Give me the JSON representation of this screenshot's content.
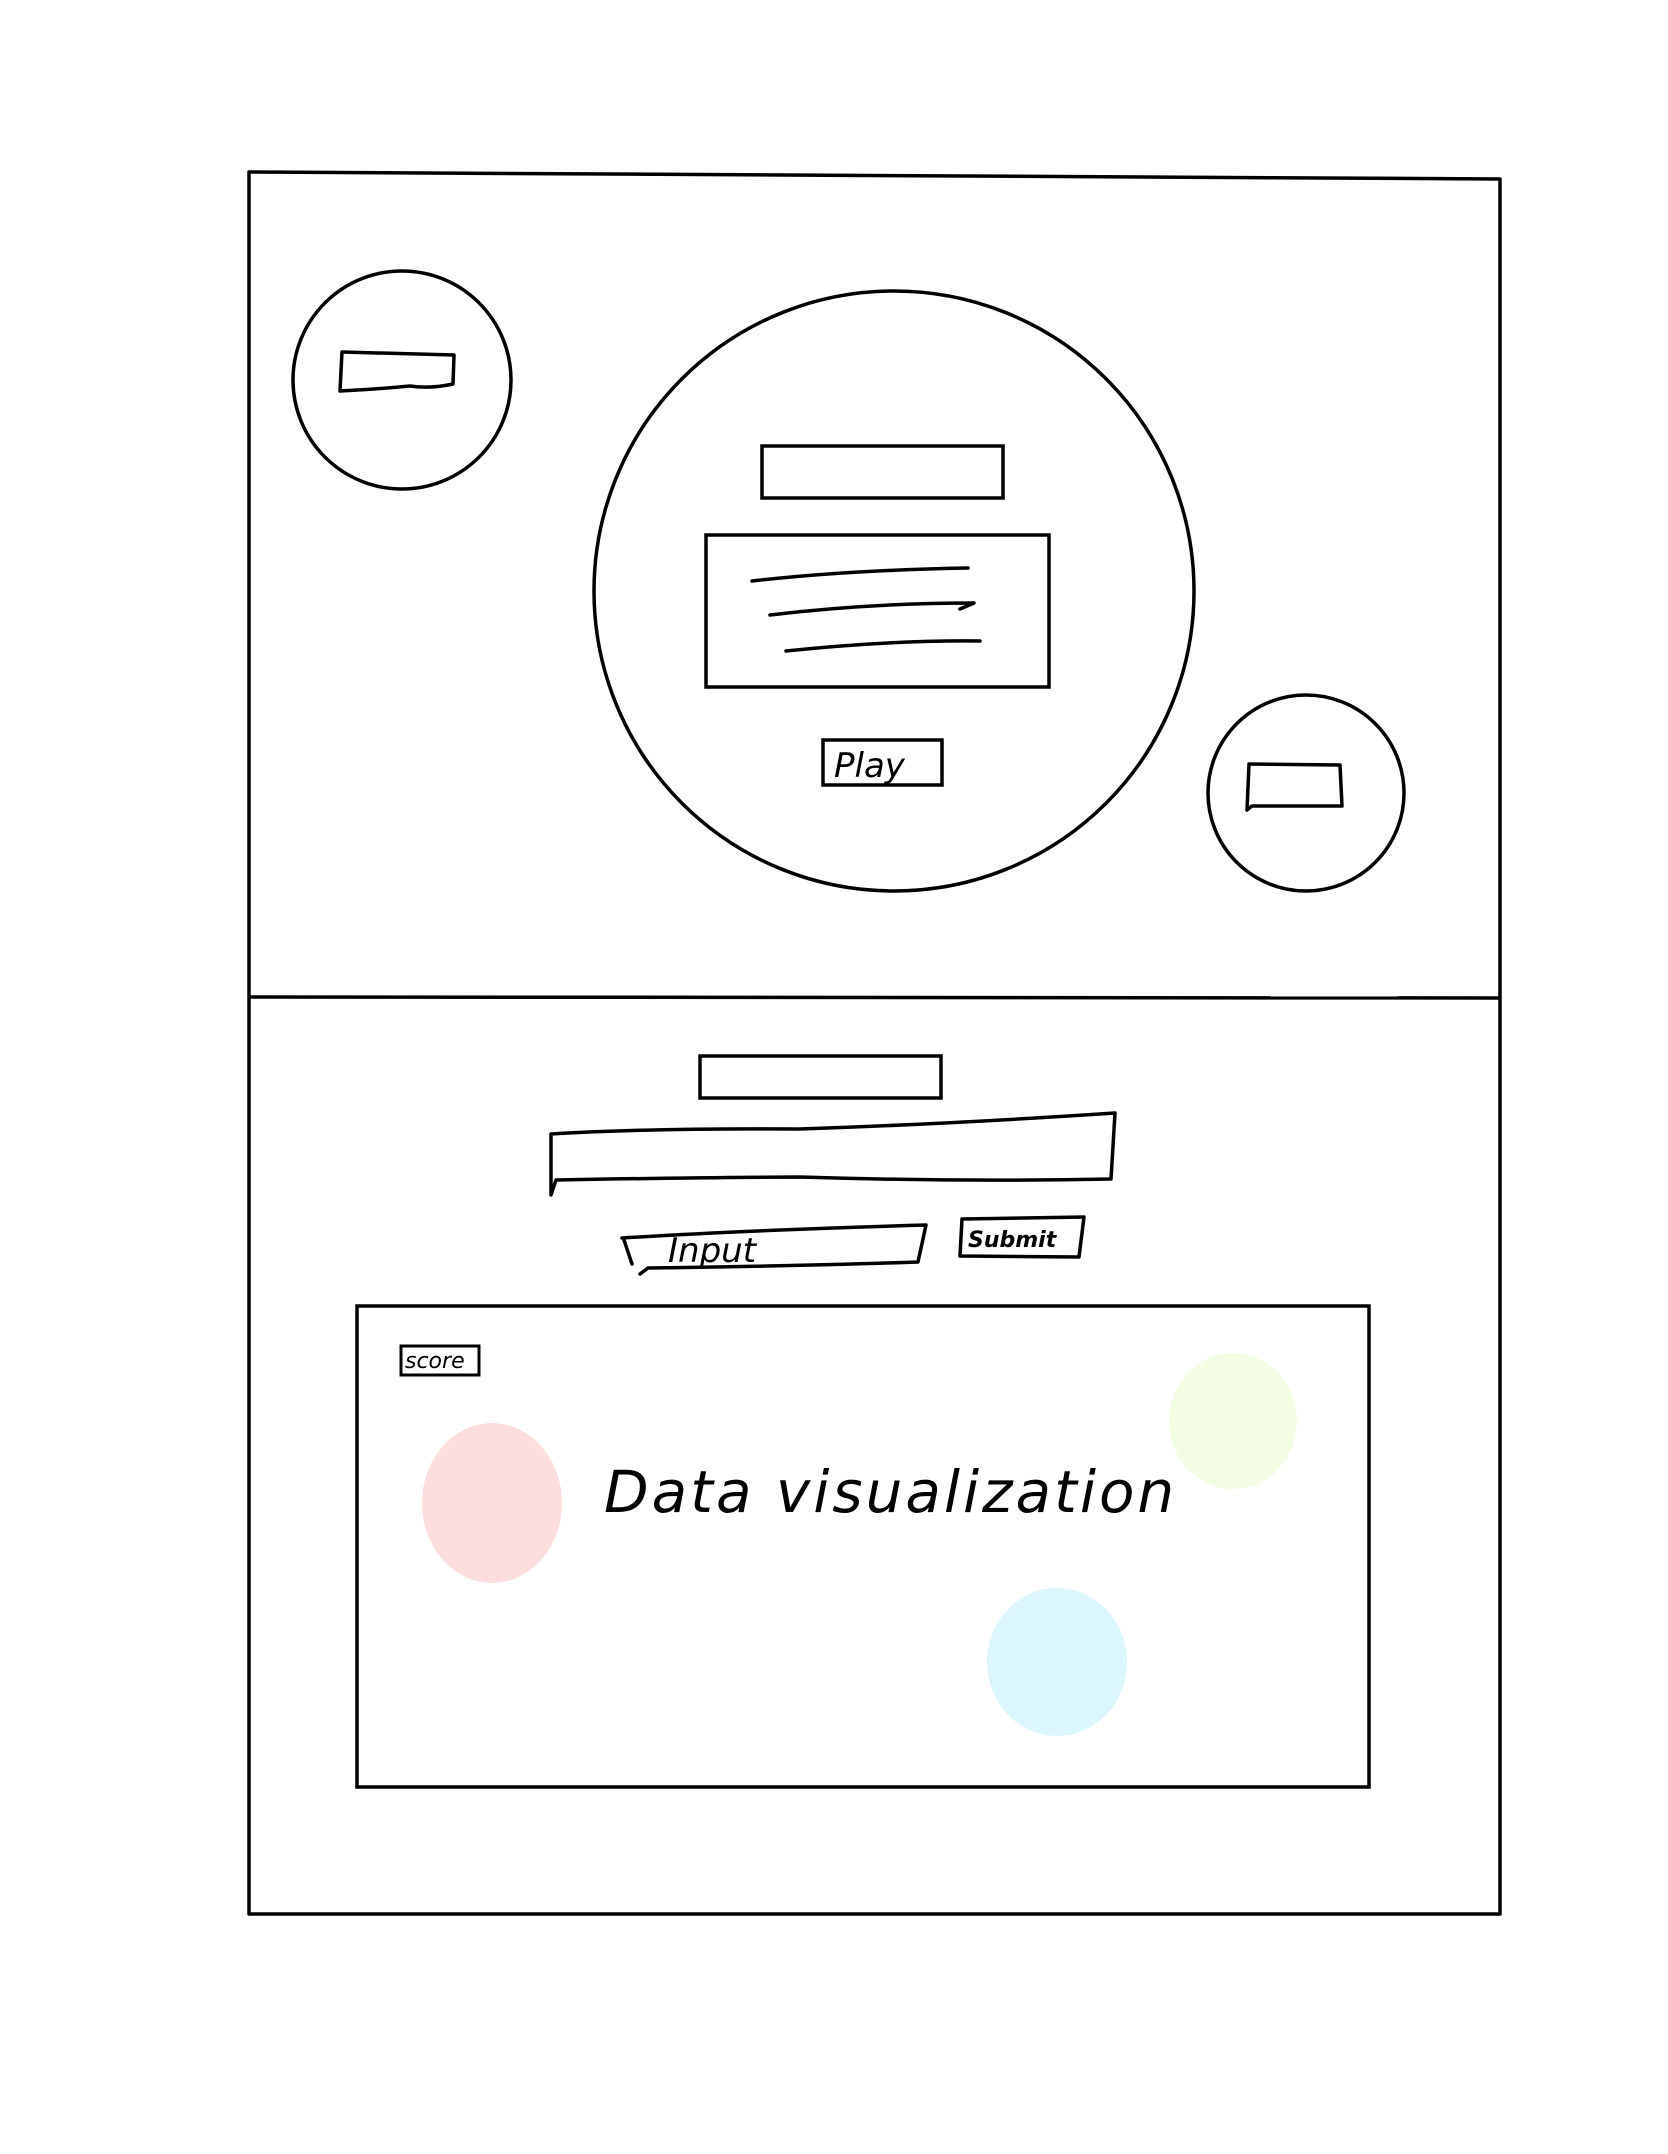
{
  "wireframe": {
    "top_panel": {
      "play_button_label": "Play"
    },
    "bottom_panel": {
      "input_placeholder": "Input",
      "submit_button_label": "Submit",
      "visualization": {
        "score_label": "score",
        "caption": "Data visualization"
      }
    }
  },
  "colors": {
    "ink": "#000000",
    "blob_red": "#fddede",
    "blob_yellow": "#f3fde3",
    "blob_blue": "#dcf6fd"
  }
}
